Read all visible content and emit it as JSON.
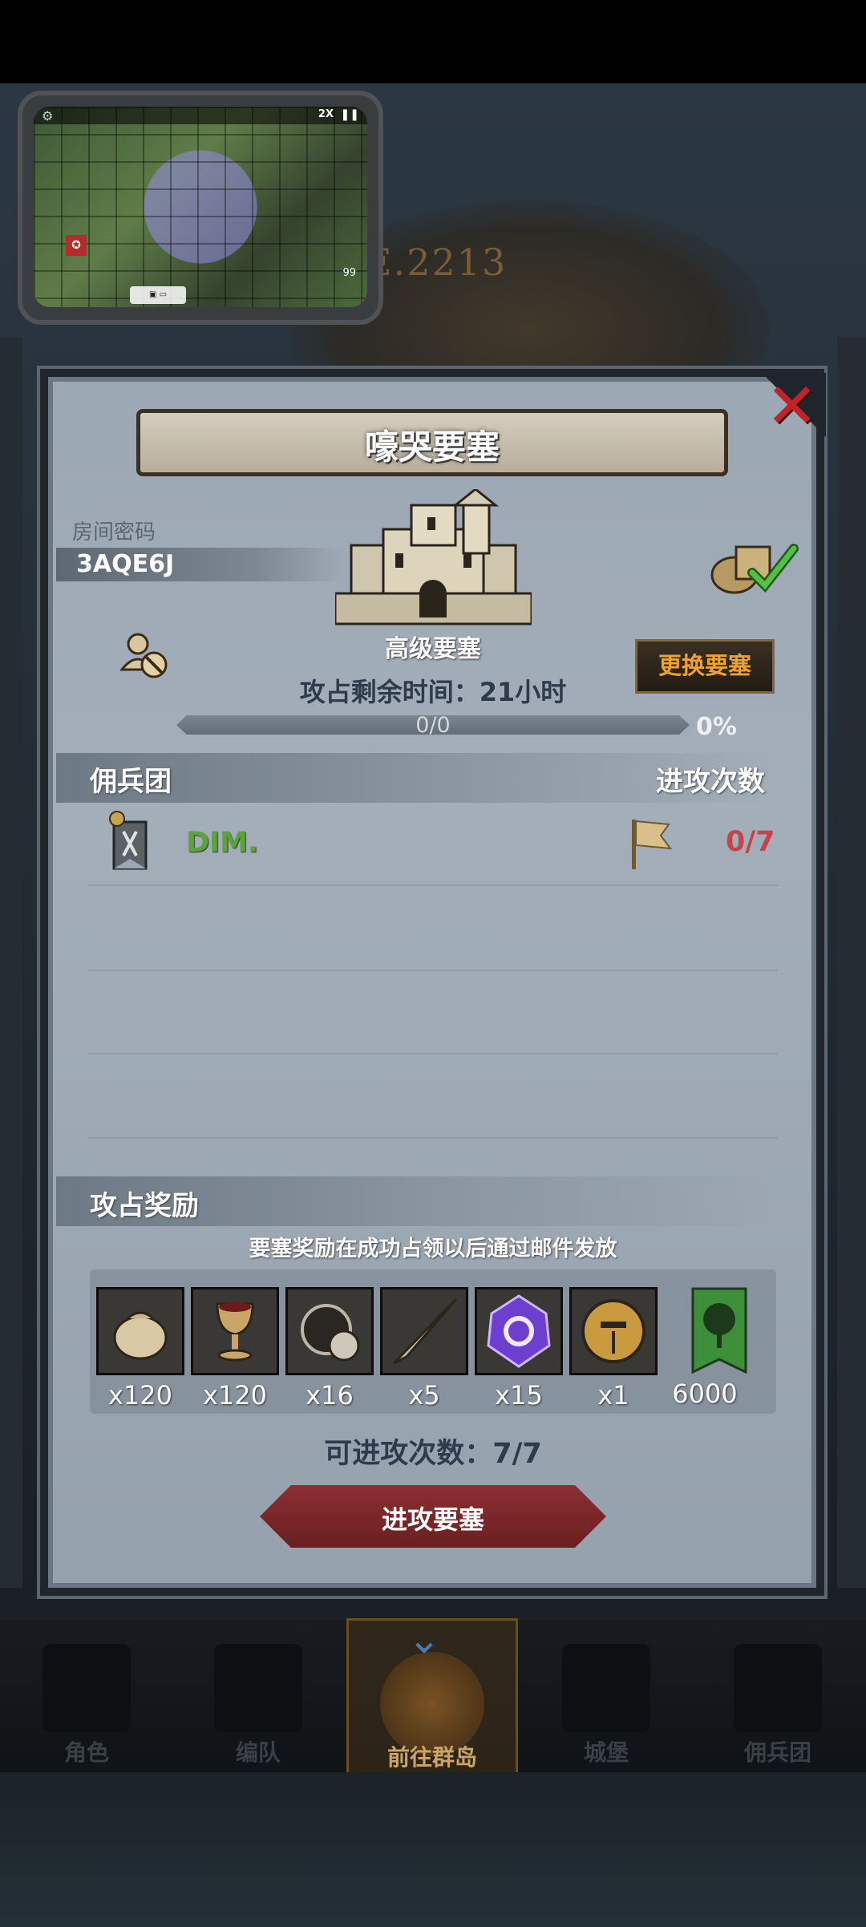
{
  "mini_video": {
    "speed": "2X",
    "life": "99",
    "button": ""
  },
  "background": {
    "era_text": "E.2213"
  },
  "dialog": {
    "title": "嚎哭要塞",
    "room_label": "房间密码",
    "room_code": "3AQE6J",
    "fortress_name": "高级要塞",
    "change_button": "更换要塞",
    "remaining_time": "攻占剩余时间：21小时",
    "progress_text": "0/0",
    "progress_percent": "0%",
    "progress_value": 0,
    "mercenary_header": "佣兵团",
    "attacks_header": "进攻次数",
    "guild": {
      "name": "DIM.",
      "attack_count": "0/7"
    },
    "reward_header": "攻占奖励",
    "reward_note": "要塞奖励在成功占领以后通过邮件发放",
    "rewards": [
      {
        "icon": "grain-sack-icon",
        "qty": "x120"
      },
      {
        "icon": "goblet-icon",
        "qty": "x120"
      },
      {
        "icon": "truffle-icon",
        "qty": "x16"
      },
      {
        "icon": "unicorn-horn-icon",
        "qty": "x5"
      },
      {
        "icon": "purple-crystal-icon",
        "qty": "x15"
      },
      {
        "icon": "knight-helmet-icon",
        "qty": "x1"
      },
      {
        "icon": "green-tree-banner-icon",
        "qty": "6000"
      }
    ],
    "available_attacks": "可进攻次数：7/7",
    "attack_button": "进攻要塞"
  },
  "bottom_nav": {
    "items": [
      "角色",
      "编队",
      "前往群岛",
      "城堡",
      "佣兵团"
    ],
    "active_index": 2
  },
  "colors": {
    "close_x": "#c3222a",
    "change_button_text": "#f0a230",
    "guild_name": "#5aa33d",
    "attack_count": "#c9424a",
    "attack_button": "#8c2f31"
  }
}
